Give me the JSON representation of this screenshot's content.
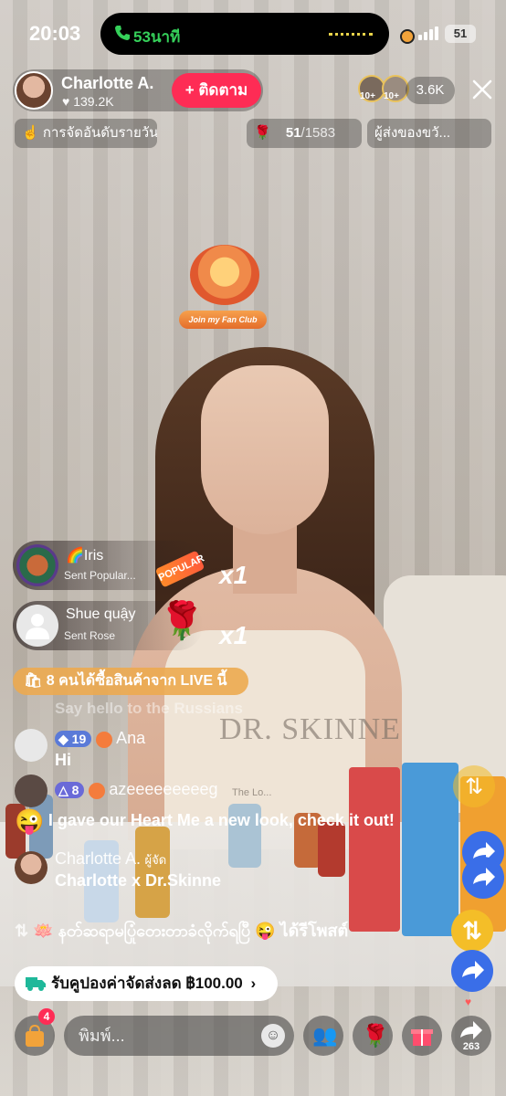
{
  "status_bar": {
    "time": "20:03",
    "call_duration": "53นาที",
    "battery": "51"
  },
  "host": {
    "name": "Charlotte A.",
    "likes": "139.2K",
    "follow_label": "+ ติดตาม"
  },
  "viewers": {
    "badge1": "10+",
    "badge2": "10+",
    "count": "3.6K"
  },
  "info_row": {
    "ranking_label": "การจัดอันดับรายวัน",
    "goal_current": "51",
    "goal_total": "/1583",
    "gifters_label": "ผู้ส่งของขวั..."
  },
  "fan_club": {
    "label": "Join my Fan Club"
  },
  "gifts": [
    {
      "name": "Iris",
      "sub": "Sent Popular...",
      "tag": "POPULAR",
      "count": "x1"
    },
    {
      "name": "Shue quậy",
      "sub": "Sent Rose",
      "count": "x1"
    }
  ],
  "purchase_banner": "8 คนได้ซื้อสินค้าจาก LIVE นี้",
  "comments": [
    {
      "text_faded": "Say hello to the Russians"
    },
    {
      "level": "19",
      "name": "Ana",
      "text": "Hi"
    },
    {
      "level": "8",
      "name": "azeeeeeeeeeg"
    },
    {
      "text": "I gave our Heart Me a new look, check it out!"
    },
    {
      "name": "Charlotte A.",
      "role": "ผู้จัด",
      "text": "Charlotte x Dr.Skinne"
    },
    {
      "text": "နတ်ဆရာမပြုံတေးတာခံလိုက်ရပြီ 😜 ได้รีโพสต์"
    }
  ],
  "product_brand": "DR. SKINNE",
  "product_tagline": "The Lo...",
  "coupon": {
    "label": "รับคูปองค่าจัดส่งลด ฿100.00",
    "arrow": "›"
  },
  "bottom_bar": {
    "cart_badge": "4",
    "input_placeholder": "พิมพ์...",
    "share_count": "263"
  }
}
